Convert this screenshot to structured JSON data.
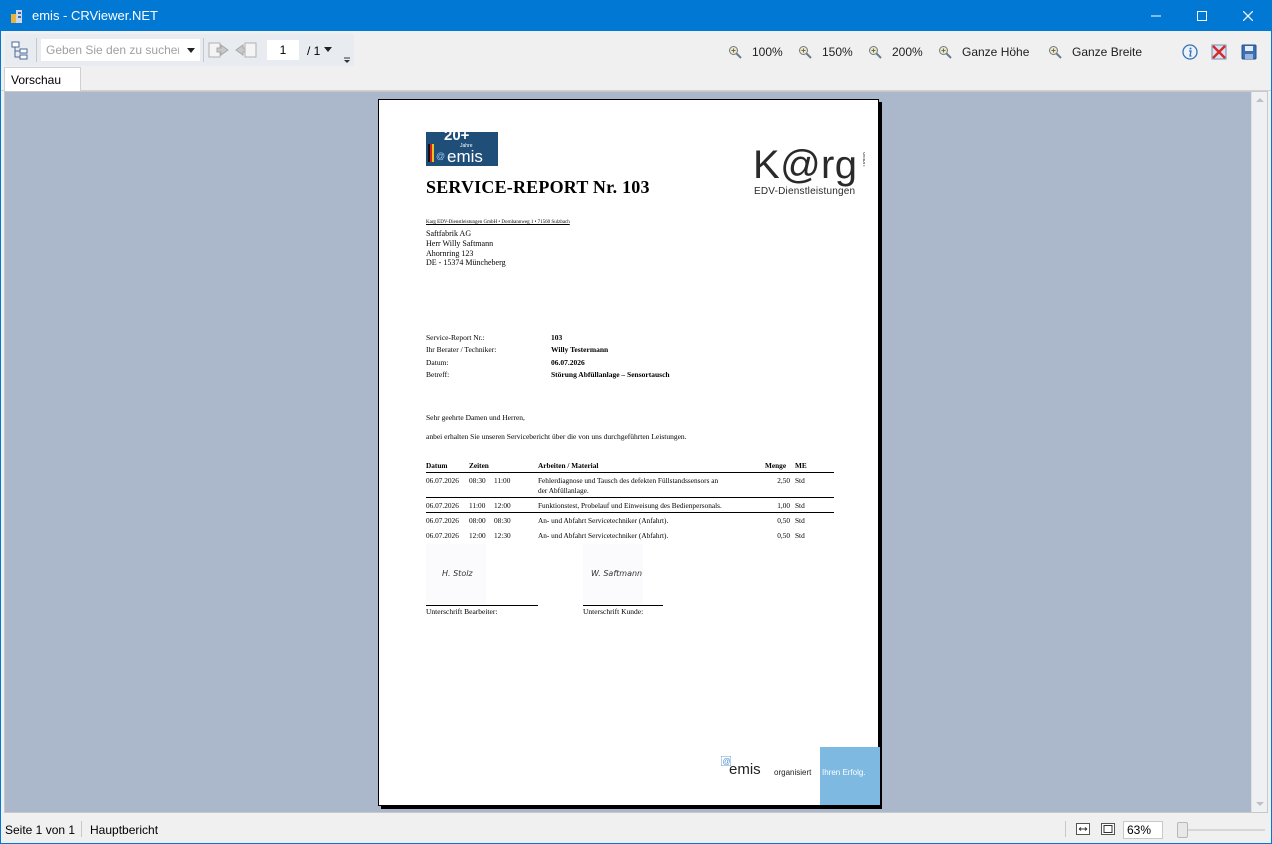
{
  "window": {
    "title": "emis - CRViewer.NET"
  },
  "toolbar": {
    "search_placeholder": "Geben Sie den zu suchen",
    "page_current": "1",
    "page_total": "/ 1",
    "zoom_buttons": [
      "100%",
      "150%",
      "200%",
      "Ganze Höhe",
      "Ganze Breite"
    ]
  },
  "tabs": {
    "active": "Vorschau"
  },
  "report": {
    "logo_emis_badge": "20+ Jahre emis",
    "logo_karg": "K@rg",
    "logo_karg_gmbh": "GmbH",
    "karg_subtitle": "EDV-Dienstleistungen",
    "title": "SERVICE-REPORT Nr. 103",
    "sender_line": "Karg EDV-Dienstleistungen GmbH • Dornbannweg 1 • 71560 Sulzbach",
    "address": [
      "Saftfabrik AG",
      "Herr Willy Saftmann",
      "Ahornring 123",
      "DE - 15374 Müncheberg"
    ],
    "meta": [
      {
        "label": "Service-Report Nr.:",
        "value": "103"
      },
      {
        "label": "Ihr Berater / Techniker:",
        "value": "Willy Testermann"
      },
      {
        "label": "Datum:",
        "value": "06.07.2026"
      },
      {
        "label": "Betreff:",
        "value": "Störung Abfüllanlage – Sensortausch"
      }
    ],
    "salutation": "Sehr geehrte Damen und Herren,",
    "intro": "anbei erhalten Sie unseren Servicebericht über die von uns durchgeführten Leistungen.",
    "table": {
      "headers": {
        "datum": "Datum",
        "zeiten": "Zeiten",
        "arbeiten": "Arbeiten / Material",
        "menge": "Menge",
        "me": "ME"
      },
      "rows": [
        {
          "datum": "06.07.2026",
          "von": "08:30",
          "bis": "11:00",
          "text1": "Fehlerdiagnose und Tausch des defekten Füllstandssensors an",
          "text2": "der Abfüllanlage.",
          "menge": "2,50",
          "me": "Std"
        },
        {
          "datum": "06.07.2026",
          "von": "11:00",
          "bis": "12:00",
          "text1": "Funktionstest, Probelauf und Einweisung des Bedienpersonals.",
          "text2": "",
          "menge": "1,00",
          "me": "Std"
        },
        {
          "datum": "06.07.2026",
          "von": "08:00",
          "bis": "08:30",
          "text1": "An- und Abfahrt Servicetechniker (Anfahrt).",
          "text2": "",
          "menge": "0,50",
          "me": "Std"
        },
        {
          "datum": "06.07.2026",
          "von": "12:00",
          "bis": "12:30",
          "text1": "An- und Abfahrt Servicetechniker (Abfahrt).",
          "text2": "",
          "menge": "0,50",
          "me": "Std"
        }
      ]
    },
    "signatures": {
      "left_label": "Unterschrift Bearbeiter:",
      "left_sig": "H. Stolz",
      "right_label": "Unterschrift Kunde:",
      "right_sig": "W. Saftmann"
    },
    "footer": {
      "emis": "emis",
      "organisiert": "organisiert",
      "erfolg": "Ihren Erfolg."
    }
  },
  "statusbar": {
    "page_info": "Seite 1 von 1",
    "report_name": "Hauptbericht",
    "zoom": "63%",
    "zoom_level": 0.63
  },
  "colors": {
    "titlebar": "#0078d4",
    "viewer_bg": "#abb8cc",
    "banner_blue": "#7db9e0",
    "emis_logo": "#1f4e79"
  }
}
